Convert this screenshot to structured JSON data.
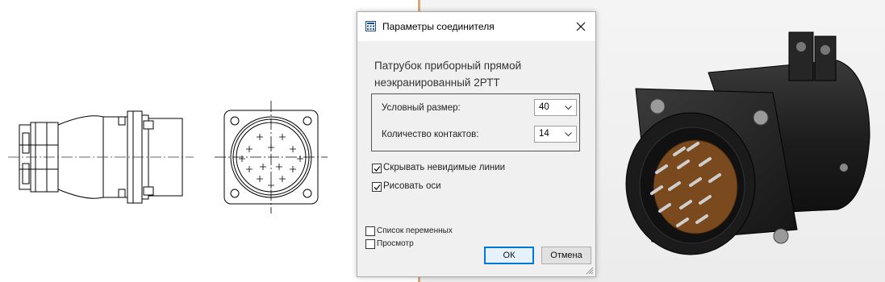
{
  "dialog": {
    "title": "Параметры соединителя",
    "heading_line1": "Патрубок приборный прямой",
    "heading_line2": "неэкранированный 2РТТ",
    "size_label": "Условный размер:",
    "size_value": "40",
    "contacts_label": "Количество контактов:",
    "contacts_value": "14",
    "hide_lines_label": "Скрывать невидимые линии",
    "hide_lines_checked": true,
    "draw_axes_label": "Рисовать оси",
    "draw_axes_checked": true,
    "variables_label": "Список переменных",
    "variables_checked": false,
    "preview_label": "Просмотр",
    "preview_checked": false,
    "ok_label": "ОК",
    "cancel_label": "Отмена"
  },
  "colors": {
    "accent": "#0078d7",
    "connector_body": "#2a2a2a",
    "insulator": "#7a4a1e",
    "pin": "#cfcfcf"
  }
}
